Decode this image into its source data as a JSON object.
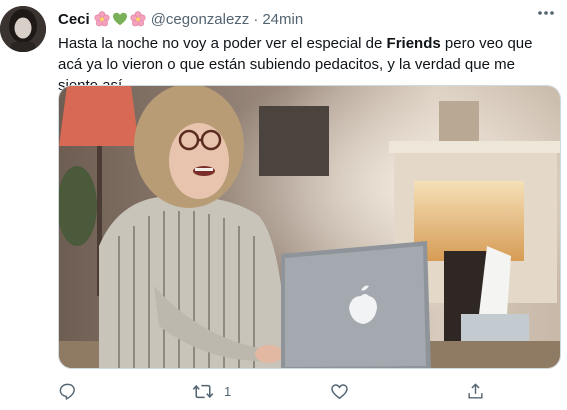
{
  "tweet": {
    "display_name": "Ceci",
    "emojis": [
      "cherry-blossom-emoji",
      "green-heart-emoji",
      "cherry-blossom-emoji"
    ],
    "handle": "@cegonzalezz",
    "separator": "·",
    "time": "24min",
    "text_part1": "Hasta la noche no voy a poder ver el especial de ",
    "text_bold": "Friends",
    "text_part2": " pero veo que acá ya lo vieron o que están subiendo pedacitos, y la verdad que me siento así",
    "media_alt": "woman-crying-at-laptop",
    "actions": {
      "reply_icon": "reply-icon",
      "retweet_icon": "retweet-icon",
      "retweet_count": "1",
      "like_icon": "heart-icon",
      "share_icon": "share-icon"
    }
  },
  "colors": {
    "text": "#0f1419",
    "secondary": "#536471",
    "divider": "#cfd9de",
    "emoji_pink": "#f4a3bd",
    "emoji_green": "#78b159"
  }
}
